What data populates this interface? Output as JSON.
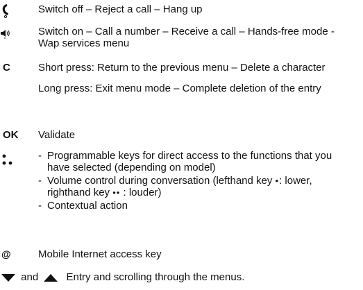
{
  "entries": {
    "hangup": {
      "icon": "hang-up-phone-icon",
      "text": "Switch off – Reject a call – Hang up"
    },
    "call": {
      "icon": "call-speaker-icon",
      "text": "Switch on – Call a number – Receive a call – Hands-free mode - Wap services menu"
    },
    "c_key": {
      "key_label": "C",
      "short_press": "Short press: Return to the previous menu – Delete a character",
      "long_press": "Long press: Exit menu mode – Complete deletion of the entry"
    },
    "ok_key": {
      "key_label": "OK",
      "text": "Validate"
    },
    "prog_keys": {
      "icon": "programmable-keys-dots-icon",
      "bullet_dash": "-",
      "bullet1": "Programmable keys for direct access to the functions that you have selected (depending on model)",
      "bullet2_a": "Volume control during conversation (lefthand key ",
      "bullet2_dot1": "•",
      "bullet2_b": ": lower, righthand key ",
      "bullet2_dot2": "••",
      "bullet2_c": " : louder)",
      "bullet3": "Contextual action"
    },
    "at_key": {
      "key_label": "@",
      "text": "Mobile Internet access key"
    },
    "arrows": {
      "down_icon": "down-arrow-icon",
      "up_icon": "up-arrow-icon",
      "and_label": "and",
      "text": "Entry and scrolling through the menus."
    }
  }
}
